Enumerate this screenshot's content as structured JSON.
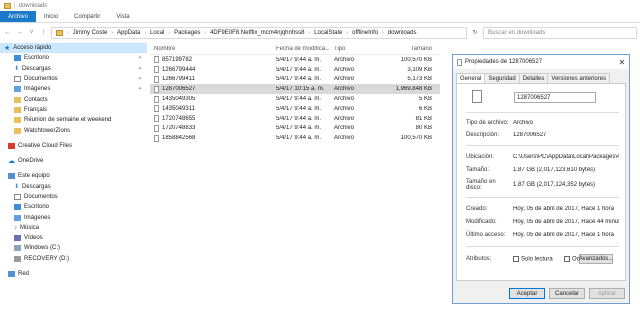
{
  "window": {
    "title": "downloads"
  },
  "ribbon": {
    "tabs": [
      "Archivo",
      "Inicio",
      "Compartir",
      "Vista"
    ]
  },
  "nav": {
    "back": "←",
    "forward": "→",
    "up": "↑",
    "recent": "˅"
  },
  "address": {
    "crumbs": [
      "Jimmy Coste",
      "AppData",
      "Local",
      "Packages",
      "4DF9E0F8.Netflix_mcm4njqhnhss8",
      "LocalState",
      "offlineInfo",
      "downloads"
    ],
    "refresh": "↻"
  },
  "search": {
    "placeholder": "Buscar en downloads"
  },
  "sidebar": {
    "quick_access": {
      "label": "Acceso rápido",
      "items": [
        "Escritorio",
        "Descargas",
        "Documentos",
        "Imágenes",
        "Contacts",
        "Français",
        "Réunion de semaine et weekend",
        "WatchtowerZions"
      ]
    },
    "creative_cloud": "Creative Cloud Files",
    "onedrive": "OneDrive",
    "this_pc": {
      "label": "Este equipo",
      "items": [
        "Descargas",
        "Documentos",
        "Escritorio",
        "Imágenes",
        "Música",
        "Vídeos",
        "Windows (C:)",
        "RECOVERY (D:)"
      ]
    },
    "network": "Red"
  },
  "files": {
    "columns": [
      "Nombre",
      "Fecha de modifica...",
      "Tipo",
      "Tamaño"
    ],
    "rows": [
      {
        "name": "857199782",
        "date": "5/4/17 9:44 a. m.",
        "type": "Archivo",
        "size": "100,570 KB"
      },
      {
        "name": "1266799444",
        "date": "5/4/17 9:44 a. m.",
        "type": "Archivo",
        "size": "3,109 KB"
      },
      {
        "name": "1266799411",
        "date": "5/4/17 9:44 a. m.",
        "type": "Archivo",
        "size": "5,173 KB"
      },
      {
        "name": "1287006527",
        "date": "5/4/17 10:15 a. m.",
        "type": "Archivo",
        "size": "1,969,848 KB"
      },
      {
        "name": "1435049305",
        "date": "5/4/17 9:44 a. m.",
        "type": "Archivo",
        "size": "5 KB"
      },
      {
        "name": "1435049311",
        "date": "5/4/17 9:44 a. m.",
        "type": "Archivo",
        "size": "6 KB"
      },
      {
        "name": "1720748655",
        "date": "5/4/17 9:44 a. m.",
        "type": "Archivo",
        "size": "81 KB"
      },
      {
        "name": "1720748833",
        "date": "5/4/17 9:44 a. m.",
        "type": "Archivo",
        "size": "80 KB"
      },
      {
        "name": "1858842568",
        "date": "5/4/17 9:44 a. m.",
        "type": "Archivo",
        "size": "100,570 KB"
      }
    ]
  },
  "dialog": {
    "title": "Propiedades de 1287006527",
    "close": "✕",
    "tabs": [
      "General",
      "Seguridad",
      "Detalles",
      "Versiones anteriores"
    ],
    "name_value": "1287006527",
    "type_label": "Tipo de archivo:",
    "type_value": "Archivo",
    "desc_label": "Descripción:",
    "desc_value": "1287006527",
    "location_label": "Ubicación:",
    "location_value": "C:\\Users\\PC\\AppData\\Local\\Packages\\4DF9",
    "size_label": "Tamaño:",
    "size_value": "1.87 GB (2,017,123,610 bytes)",
    "disk_label": "Tamaño en disco:",
    "disk_value": "1.87 GB (2,017,124,352 bytes)",
    "created_label": "Creado:",
    "created_value": "Hoy, 05 de abril de 2017, Hace 1 hora",
    "modified_label": "Modificado:",
    "modified_value": "Hoy, 05 de abril de 2017, Hace 44 minutos",
    "accessed_label": "Último acceso:",
    "accessed_value": "Hoy, 05 de abril de 2017, Hace 1 hora",
    "attrs_label": "Atributos:",
    "readonly_label": "Solo lectura",
    "hidden_label": "Oculto",
    "advanced_button": "Avanzados...",
    "ok_button": "Aceptar",
    "cancel_button": "Cancelar",
    "apply_button": "Aplicar"
  },
  "colors": {
    "accent": "#1979ca",
    "selection": "#cce8ff",
    "folder": "#e8c15c"
  }
}
